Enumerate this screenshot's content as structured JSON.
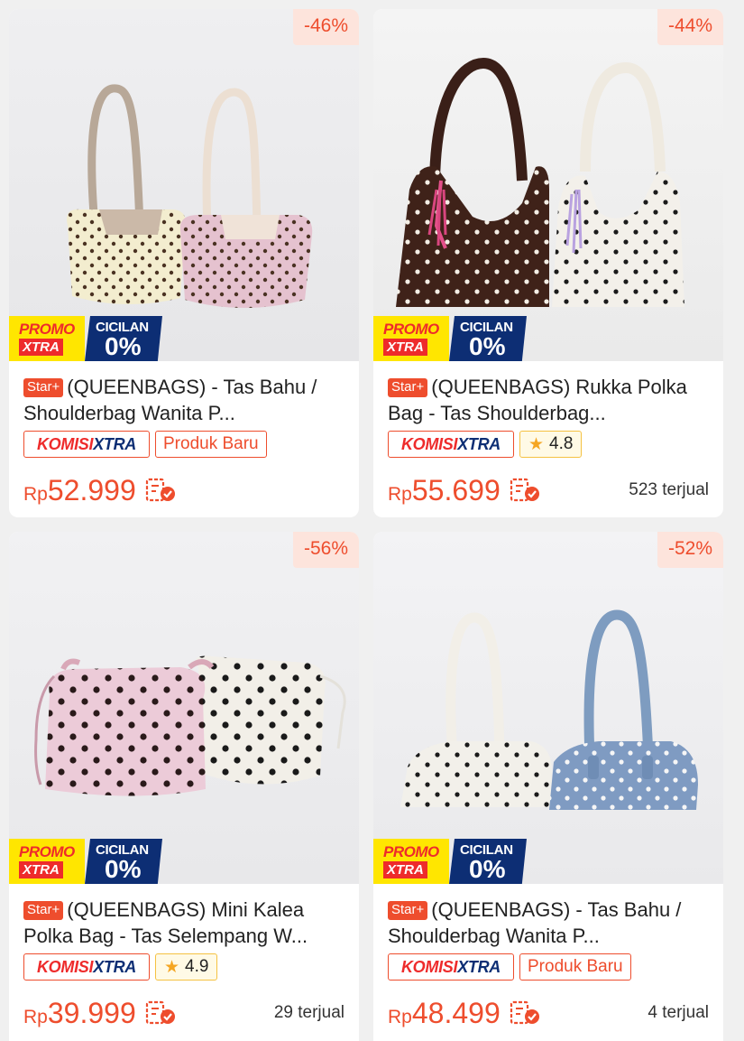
{
  "colors": {
    "accent": "#ee4d2d",
    "promo_yellow": "#ffe600",
    "navy": "#0d2e74"
  },
  "badges": {
    "promo_line1": "PROMO",
    "promo_line2": "XTRA",
    "cicilan_line1": "CICILAN",
    "cicilan_line2": "0%",
    "star_tag": "Star+",
    "komisi_part1": "KOMISI",
    "komisi_part2": "XTRA",
    "new_label": "Produk Baru"
  },
  "products": [
    {
      "discount": "-46%",
      "name": "(QUEENBAGS) - Tas Bahu / Shoulderbag Wanita P...",
      "currency": "Rp",
      "price": "52.999",
      "rating": null,
      "is_new": true,
      "sold": ""
    },
    {
      "discount": "-44%",
      "name": "(QUEENBAGS) Rukka Polka Bag - Tas Shoulderbag...",
      "currency": "Rp",
      "price": "55.699",
      "rating": "4.8",
      "is_new": false,
      "sold": "523 terjual"
    },
    {
      "discount": "-56%",
      "name": "(QUEENBAGS) Mini Kalea Polka Bag - Tas Selempang W...",
      "currency": "Rp",
      "price": "39.999",
      "rating": "4.9",
      "is_new": false,
      "sold": "29 terjual"
    },
    {
      "discount": "-52%",
      "name": "(QUEENBAGS) - Tas Bahu / Shoulderbag Wanita P...",
      "currency": "Rp",
      "price": "48.499",
      "rating": null,
      "is_new": true,
      "sold": "4 terjual"
    }
  ]
}
